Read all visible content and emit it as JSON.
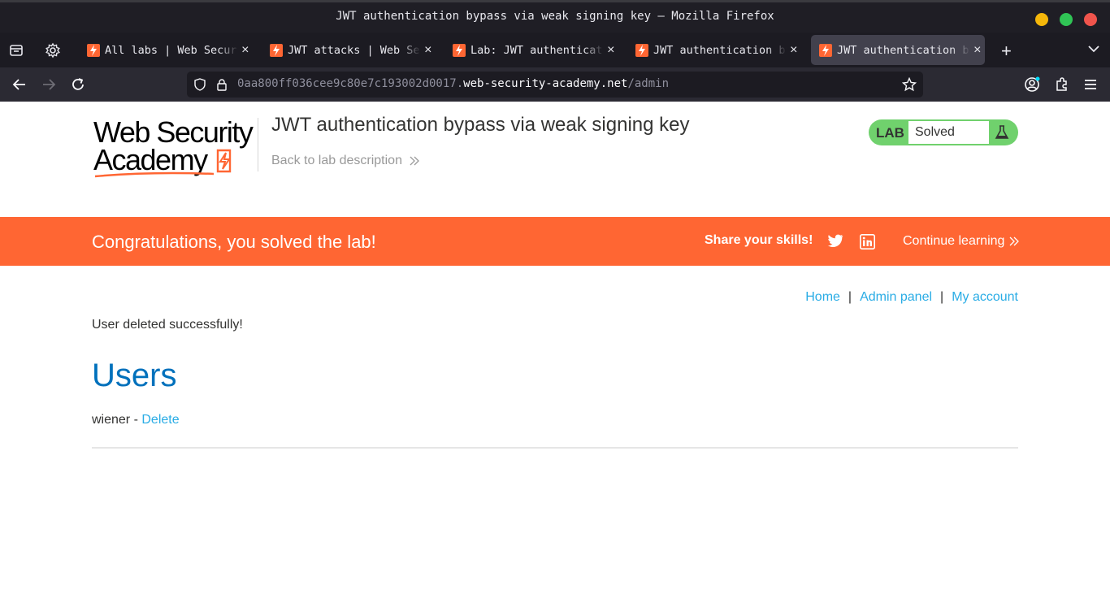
{
  "window": {
    "title": "JWT authentication bypass via weak signing key — Mozilla Firefox",
    "controls": {
      "minimize_color": "#f5b70a",
      "maximize_color": "#30c455",
      "close_color": "#f0544c"
    }
  },
  "tabs": [
    {
      "label": "All labs | Web Security Academy",
      "active": false
    },
    {
      "label": "JWT attacks | Web Security Academy",
      "active": false
    },
    {
      "label": "Lab: JWT authentication bypass",
      "active": false
    },
    {
      "label": "JWT authentication bypass",
      "active": false
    },
    {
      "label": "JWT authentication bypass",
      "active": true
    }
  ],
  "tab_close_glyph": "×",
  "new_tab_glyph": "+",
  "navbar": {
    "url_prefix": "0aa800ff036cee9c80e7c193002d0017.",
    "url_host": "web-security-academy.net",
    "url_path": "/admin"
  },
  "logo": {
    "line1": "Web Security",
    "line2": "Academy"
  },
  "header": {
    "lab_title": "JWT authentication bypass via weak signing key",
    "back_link": "Back to lab description"
  },
  "status_badge": {
    "lab_label": "LAB",
    "status": "Solved",
    "color": "#70d16d"
  },
  "banner": {
    "message": "Congratulations, you solved the lab!",
    "share_label": "Share your skills!",
    "continue_label": "Continue learning",
    "color": "#ff6633"
  },
  "top_nav": {
    "home": "Home",
    "admin": "Admin panel",
    "account": "My account",
    "separator": "|"
  },
  "main": {
    "message": "User deleted successfully!",
    "heading": "Users",
    "users": [
      {
        "name": "wiener",
        "separator": " - ",
        "action": "Delete"
      }
    ]
  },
  "colors": {
    "accent_link": "#29ace5",
    "heading_blue": "#0071bc",
    "text": "#333332"
  }
}
